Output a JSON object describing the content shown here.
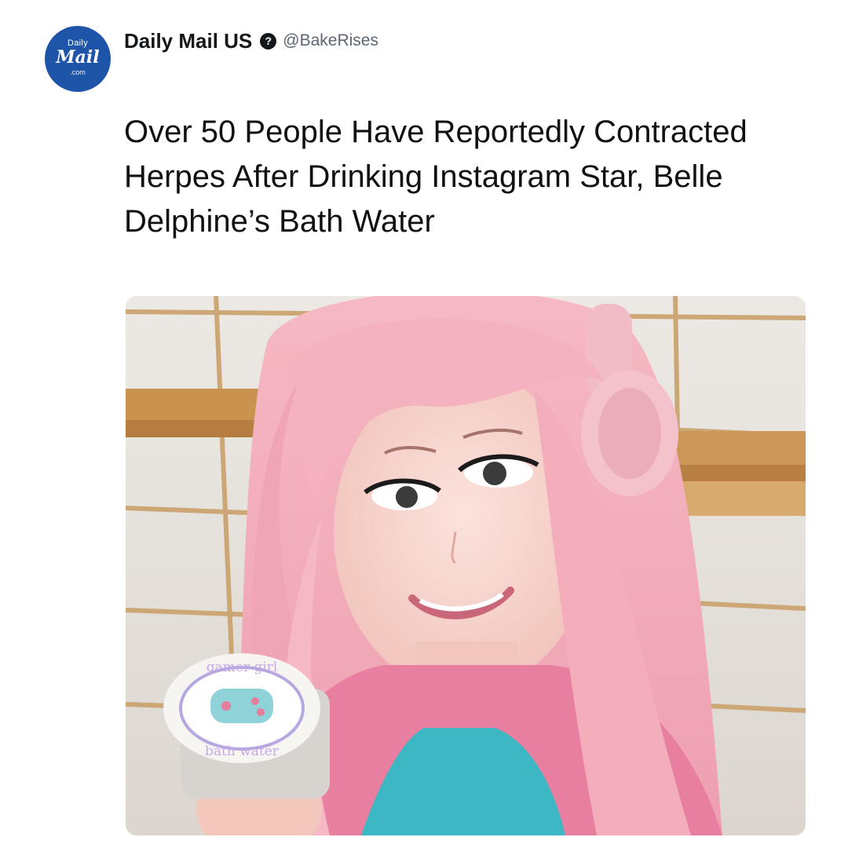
{
  "post": {
    "avatar": {
      "line1": "Daily",
      "line2": "Mail",
      "line3": ".com"
    },
    "author_name": "Daily Mail US",
    "verified_glyph": "?",
    "handle": "@BakeRises",
    "headline": "Over 50 People Have Reportedly Contracted Herpes After Drinking Instagram Star, Belle Delphine’s Bath Water"
  },
  "photo": {
    "label_text_top": "gamer girl",
    "label_text_bottom": "bath water"
  },
  "colors": {
    "brand_blue": "#1f55a8",
    "hair_pink": "#f2aab7",
    "headphones_pink": "#f1bcc6"
  }
}
